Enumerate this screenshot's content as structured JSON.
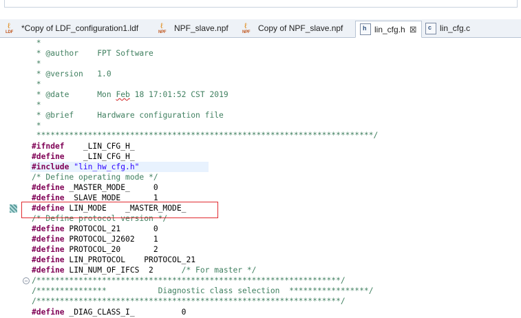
{
  "tabs": [
    {
      "label": "*Copy of LDF_configuration1.ldf",
      "icon": "ldf-file-icon",
      "icon_text": "LDF"
    },
    {
      "label": "NPF_slave.npf",
      "icon": "npf-file-icon",
      "icon_text": "NPF"
    },
    {
      "label": "Copy of NPF_slave.npf",
      "icon": "npf-file-icon",
      "icon_text": "NPF"
    },
    {
      "label": "lin_cfg.h",
      "icon": "h-file-icon",
      "icon_text": "h",
      "active": true,
      "close": "⊠"
    },
    {
      "label": "lin_cfg.c",
      "icon": "c-file-icon",
      "icon_text": "c"
    }
  ],
  "code": {
    "l1": " *",
    "l2a": " * @author",
    "l2b": "    FPT Software",
    "l3": " *",
    "l4a": " * @version",
    "l4b": "   1.0",
    "l5": " *",
    "l6a": " * @date",
    "l6b": "      Mon ",
    "l6c": "Feb",
    "l6d": " 18 17:01:52 CST 2019",
    "l7": " *",
    "l8a": " * @brief",
    "l8b": "     Hardware configuration file",
    "l9": " *",
    "l10": " ************************************************************************/",
    "l11k": "#ifndef",
    "l11p": "    _LIN_CFG_H_",
    "l12k": "#define",
    "l12p": "    _LIN_CFG_H_",
    "l13k": "#include",
    "l13s": " \"lin_hw_cfg.h\"",
    "l14": "/* Define operating mode */",
    "l15k": "#define",
    "l15p": " _MASTER_MODE_     0",
    "l16k": "#define",
    "l16p": " _SLAVE_MODE_      1",
    "l17k": "#define",
    "l17p": " LIN_MODE    _MASTER_MODE_",
    "l18": "/* Define protocol version */",
    "l19k": "#define",
    "l19p": " PROTOCOL_21       0",
    "l20k": "#define",
    "l20p": " PROTOCOL_J2602    1",
    "l21k": "#define",
    "l21p": " PROTOCOL_20       2",
    "l22k": "#define",
    "l22p": " LIN_PROTOCOL    PROTOCOL_21",
    "l23k": "#define",
    "l23p": " LIN_NUM_OF_IFCS  2      ",
    "l23c": "/* For master */",
    "l24": "/*****************************************************************/",
    "l25": "/***************           Diagnostic class selection  *****************/",
    "l26": "/*****************************************************************/",
    "l27k": "#define",
    "l27p": " _DIAG_CLASS_I_          0",
    "fold": "−"
  }
}
